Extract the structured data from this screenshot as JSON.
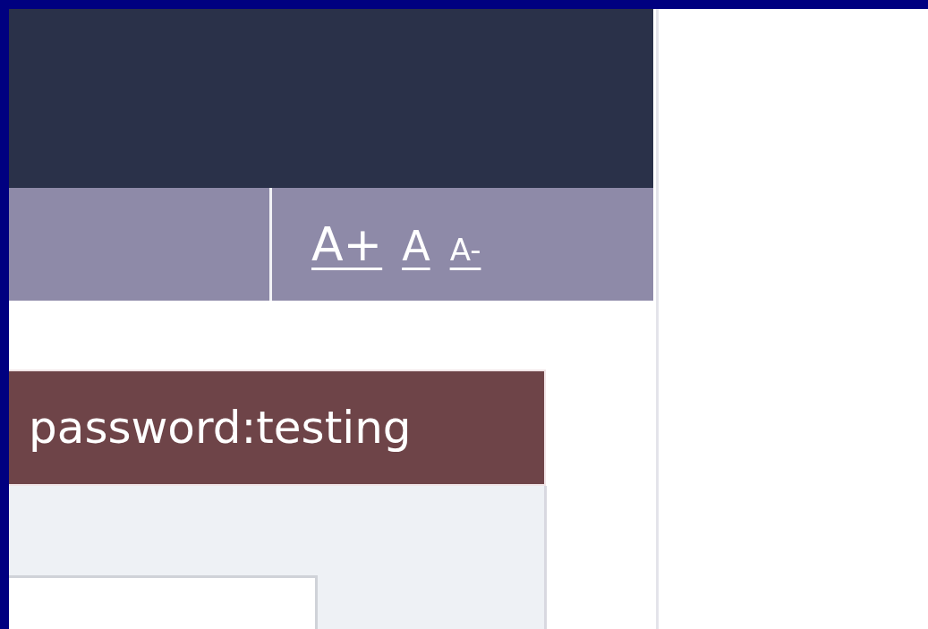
{
  "font_size_controls": [
    {
      "label": "A+",
      "kind": "larger"
    },
    {
      "label": "A",
      "kind": "normal"
    },
    {
      "label": "A-",
      "kind": "smaller"
    }
  ],
  "notice": {
    "text": "password:testing"
  }
}
